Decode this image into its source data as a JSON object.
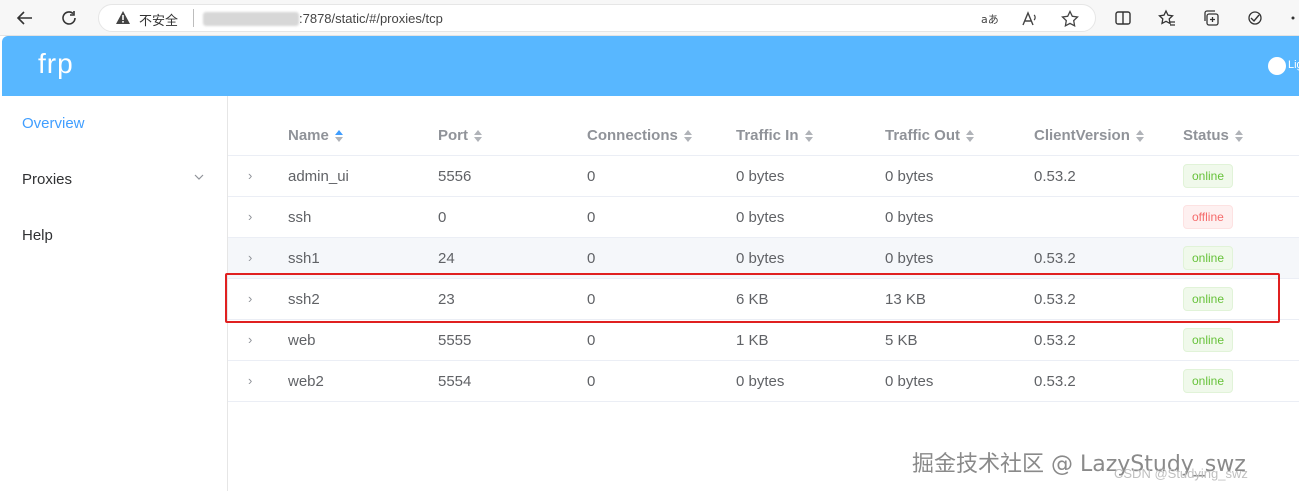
{
  "browser": {
    "security_label": "不安全",
    "url": ":7878/static/#/proxies/tcp"
  },
  "app": {
    "brand": "frp",
    "theme_toggle_label": "Lig"
  },
  "sidebar": {
    "items": [
      {
        "label": "Overview",
        "active": true
      },
      {
        "label": "Proxies",
        "active": false,
        "expandable": true
      },
      {
        "label": "Help",
        "active": false
      }
    ]
  },
  "table": {
    "headers": [
      "Name",
      "Port",
      "Connections",
      "Traffic In",
      "Traffic Out",
      "ClientVersion",
      "Status"
    ],
    "rows": [
      {
        "name": "admin_ui",
        "port": "5556",
        "connections": "0",
        "traffic_in": "0 bytes",
        "traffic_out": "0 bytes",
        "client_version": "0.53.2",
        "status": "online"
      },
      {
        "name": "ssh",
        "port": "0",
        "connections": "0",
        "traffic_in": "0 bytes",
        "traffic_out": "0 bytes",
        "client_version": "",
        "status": "offline"
      },
      {
        "name": "ssh1",
        "port": "24",
        "connections": "0",
        "traffic_in": "0 bytes",
        "traffic_out": "0 bytes",
        "client_version": "0.53.2",
        "status": "online"
      },
      {
        "name": "ssh2",
        "port": "23",
        "connections": "0",
        "traffic_in": "6 KB",
        "traffic_out": "13 KB",
        "client_version": "0.53.2",
        "status": "online"
      },
      {
        "name": "web",
        "port": "5555",
        "connections": "0",
        "traffic_in": "1 KB",
        "traffic_out": "5 KB",
        "client_version": "0.53.2",
        "status": "online"
      },
      {
        "name": "web2",
        "port": "5554",
        "connections": "0",
        "traffic_in": "0 bytes",
        "traffic_out": "0 bytes",
        "client_version": "0.53.2",
        "status": "online"
      }
    ]
  },
  "watermark": {
    "main": "掘金技术社区 @ LazyStudy_swz",
    "sub": "CSDN @Studying_swz"
  },
  "colors": {
    "header_bg": "#58b7ff",
    "active_link": "#409eff",
    "online": "#67c23a",
    "offline": "#f56c6c",
    "highlight": "#e02020"
  }
}
